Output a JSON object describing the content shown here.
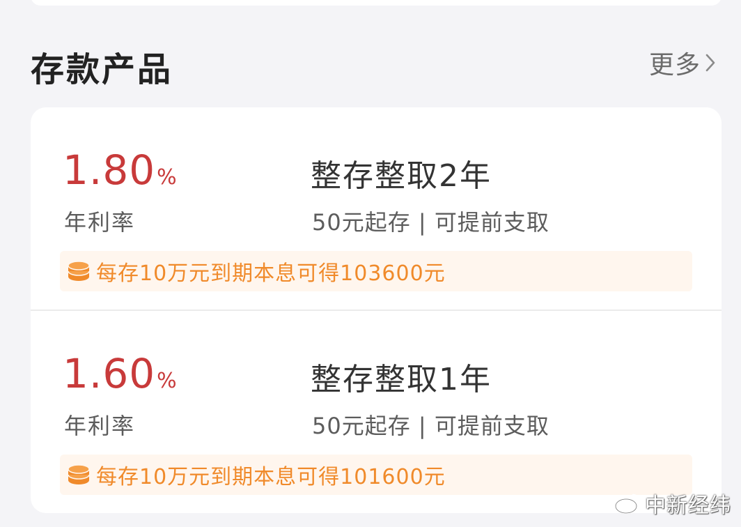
{
  "section": {
    "title": "存款产品",
    "more_label": "更多"
  },
  "products": [
    {
      "rate_value": "1.80",
      "rate_unit": "%",
      "rate_label": "年利率",
      "name": "整存整取2年",
      "description": "50元起存 | 可提前支取",
      "benefit": "每存10万元到期本息可得103600元"
    },
    {
      "rate_value": "1.60",
      "rate_unit": "%",
      "rate_label": "年利率",
      "name": "整存整取1年",
      "description": "50元起存 | 可提前支取",
      "benefit": "每存10万元到期本息可得101600元"
    }
  ],
  "watermark": {
    "text": "中新经纬"
  },
  "icons": {
    "more": "chevron-right-icon",
    "benefit": "coin-stack-icon",
    "watermark": "weibo-icon"
  },
  "colors": {
    "rate": "#c83a3a",
    "benefit_text": "#f08a2a",
    "benefit_bg": "#fff6ee",
    "page_bg": "#f4f4f7"
  }
}
